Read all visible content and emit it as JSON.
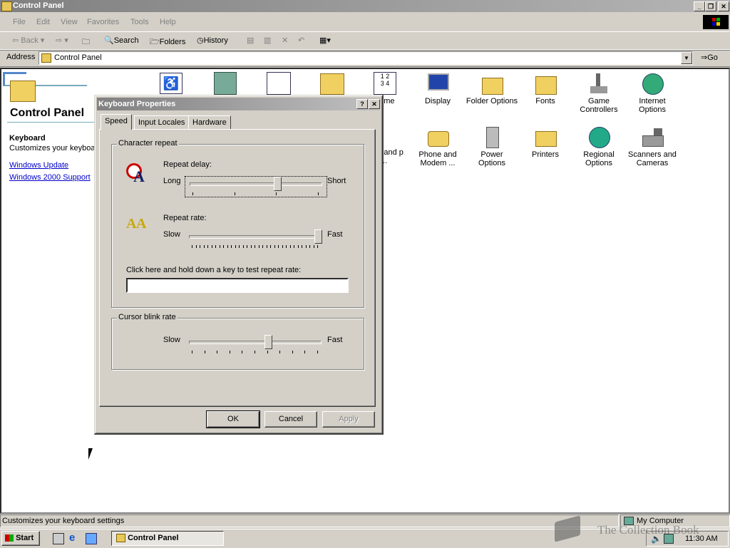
{
  "window": {
    "title": "Control Panel"
  },
  "menu": [
    "File",
    "Edit",
    "View",
    "Favorites",
    "Tools",
    "Help"
  ],
  "toolbar": {
    "back": "Back",
    "search": "Search",
    "folders": "Folders",
    "history": "History"
  },
  "address": {
    "label": "Address",
    "value": "Control Panel",
    "go": "Go"
  },
  "sidepanel": {
    "title": "Control Panel",
    "item_title": "Keyboard",
    "item_desc": "Customizes your keyboar",
    "links": [
      "Windows Update",
      "Windows 2000 Support"
    ]
  },
  "icons_row1": [
    {
      "label": "/Time"
    },
    {
      "label": "Display"
    },
    {
      "label": "Folder Options"
    },
    {
      "label": "Fonts"
    },
    {
      "label": "Game Controllers"
    },
    {
      "label": "Internet Options"
    }
  ],
  "icons_row2": [
    {
      "label": "ork and p Co..."
    },
    {
      "label": "Phone and Modem ..."
    },
    {
      "label": "Power Options"
    },
    {
      "label": "Printers"
    },
    {
      "label": "Regional Options"
    },
    {
      "label": "Scanners and Cameras"
    }
  ],
  "dialog": {
    "title": "Keyboard Properties",
    "help": "?",
    "close": "✕",
    "tabs": [
      "Speed",
      "Input Locales",
      "Hardware"
    ],
    "char_repeat": {
      "legend": "Character repeat",
      "delay_label": "Repeat delay:",
      "delay_low": "Long",
      "delay_high": "Short",
      "delay_value": 0.67,
      "rate_label": "Repeat rate:",
      "rate_low": "Slow",
      "rate_high": "Fast",
      "rate_value": 1.0,
      "test_label": "Click here and hold down a key to test repeat rate:",
      "test_value": ""
    },
    "cursor_blink": {
      "legend": "Cursor blink rate",
      "low": "Slow",
      "high": "Fast",
      "value": 0.6
    },
    "buttons": {
      "ok": "OK",
      "cancel": "Cancel",
      "apply": "Apply"
    }
  },
  "status": {
    "text": "Customizes your keyboard settings",
    "zone": "My Computer"
  },
  "taskbar": {
    "start": "Start",
    "task": "Control Panel",
    "clock": "11:30 AM"
  },
  "watermark": "The Collection Book"
}
